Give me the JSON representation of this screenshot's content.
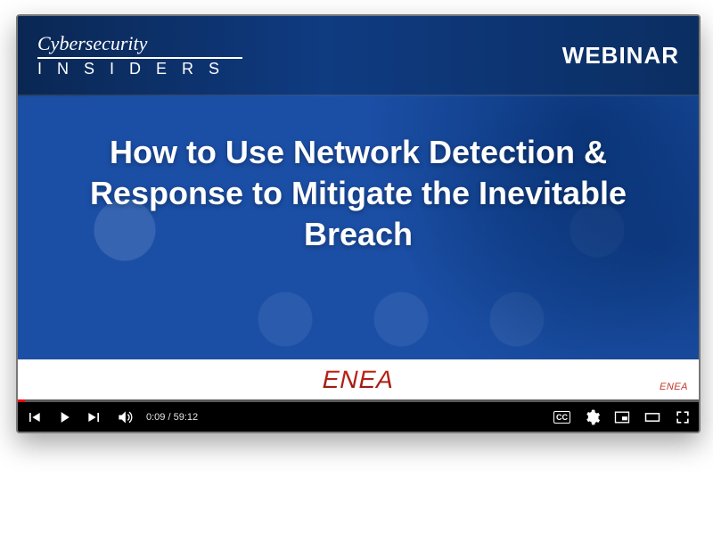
{
  "brand": {
    "line1": "Cybersecurity",
    "line2": "I N S I D E R S"
  },
  "header": {
    "label": "WEBINAR"
  },
  "title": "How to Use Network Detection & Response to Mitigate the Inevitable Breach",
  "sponsor": {
    "main": "ENEA",
    "small": "ENEA"
  },
  "player": {
    "current": "0:09",
    "duration": "59:12",
    "cc": "CC"
  }
}
